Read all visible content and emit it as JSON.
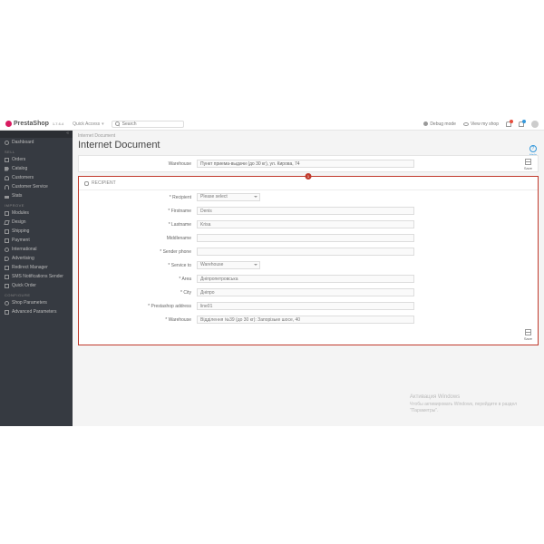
{
  "brand": {
    "name": "PrestaShop",
    "version": "1.7.6.4"
  },
  "topbar": {
    "quick": "Quick Access",
    "search_placeholder": "Search",
    "debug": "Debug mode",
    "viewshop": "View my shop"
  },
  "sidebar": {
    "dashboard": "Dashboard",
    "sect_sell": "SELL",
    "orders": "Orders",
    "catalog": "Catalog",
    "customers": "Customers",
    "custservice": "Customer Service",
    "stats": "Stats",
    "sect_improve": "IMPROVE",
    "modules": "Modules",
    "design": "Design",
    "shipping": "Shipping",
    "payment": "Payment",
    "international": "International",
    "advertising": "Advertising",
    "redirect": "Redirect Manager",
    "sms": "SMS Notifications Sender",
    "quickorder": "Quick Order",
    "sect_configure": "CONFIGURE",
    "shopparams": "Shop Parameters",
    "advparams": "Advanced Parameters"
  },
  "page": {
    "breadcrumb": "Internet Document",
    "title": "Internet Document",
    "help": "Help"
  },
  "strip": {
    "warehouse_label": "Warehouse",
    "warehouse_value": "Пункт приема-выдачи (до 30 кг), ул. Кирова, 74",
    "save": "Save"
  },
  "panel": {
    "header": "RECIPIENT",
    "error": "1",
    "rows": {
      "recipient_label": "Recipient",
      "recipient_value": "Please select",
      "firstname_label": "Firstname",
      "firstname_value": "Denis",
      "lastname_label": "Lastname",
      "lastname_value": "Krisa",
      "middlename_label": "Middlename",
      "middlename_value": "",
      "senderphone_label": "Sender phone",
      "senderphone_value": "",
      "serviceto_label": "Service to",
      "serviceto_value": "Warehouse",
      "area_label": "Area",
      "area_value": "Дніпропетровська",
      "city_label": "City",
      "city_value": "Дніпро",
      "psaddress_label": "Prestashop address",
      "psaddress_value": "line01",
      "warehouse_label": "Warehouse",
      "warehouse_value": "Відділення №39 (до 30 кг): Запорізьке шосе, 40"
    },
    "save": "Save"
  },
  "watermark": {
    "title": "Активация Windows",
    "line1": "Чтобы активировать Windows, перейдите в раздел",
    "line2": "\"Параметры\"."
  }
}
